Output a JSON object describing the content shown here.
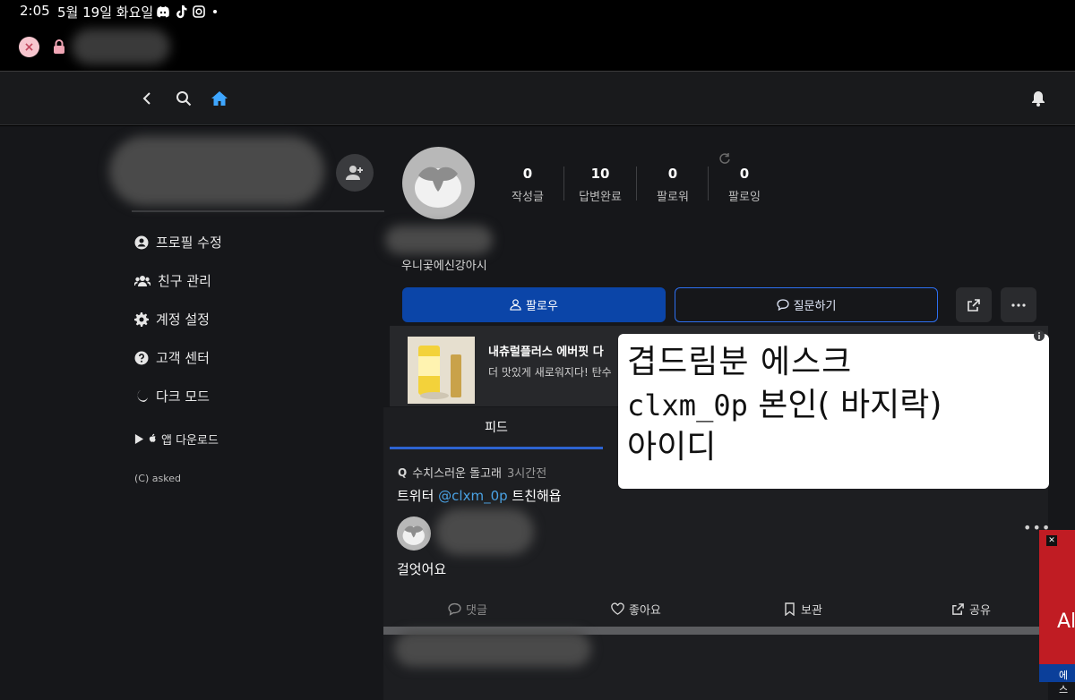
{
  "status_bar": {
    "time": "2:05",
    "date": "5월 19일 화요일",
    "icons": [
      "discord-icon",
      "tiktok-icon",
      "instagram-icon",
      "dot-icon"
    ]
  },
  "browser": {
    "close_icon": "×",
    "lock_icon": "lock-icon"
  },
  "nav": {
    "back_icon": "chevron-left-icon",
    "search_icon": "search-icon",
    "home_icon": "home-icon",
    "bell_icon": "bell-icon",
    "home_color": "#3ea6ff"
  },
  "sidebar": {
    "items": [
      {
        "label": "프로필 수정",
        "icon": "user-circle-icon"
      },
      {
        "label": "친구 관리",
        "icon": "users-icon"
      },
      {
        "label": "계정 설정",
        "icon": "gear-icon"
      },
      {
        "label": "고객 센터",
        "icon": "question-circle-icon"
      },
      {
        "label": "다크 모드",
        "icon": "moon-icon"
      }
    ],
    "app_download": "앱 다운로드",
    "copyright": "(C) asked"
  },
  "profile": {
    "stats": [
      {
        "value": "0",
        "label": "작성글"
      },
      {
        "value": "10",
        "label": "답변완료"
      },
      {
        "value": "0",
        "label": "팔로워"
      },
      {
        "value": "0",
        "label": "팔로잉"
      }
    ],
    "bio": "우니곷에신강아시",
    "follow_label": "팔로우",
    "ask_label": "질문하기"
  },
  "ad": {
    "title": "내츄럴플러스 에버핏 다",
    "desc": "더 맛있게 새로워지다! 탄수"
  },
  "feed": {
    "tab": "피드",
    "question": {
      "asker": "수치스러운 돌고래",
      "time": "3시간전",
      "prefix": "트위터 ",
      "mention": "@clxm_0p",
      "suffix": " 트친해욥"
    },
    "answer": "걸엇어요",
    "actions": {
      "comment": "댓글",
      "like": "좋아요",
      "save": "보관",
      "share": "공유"
    }
  },
  "note": {
    "line1": "겹드림분  에스크",
    "line2_mono": "clxm_0p",
    "line2_rest": " 본인( 바지락)",
    "line3": "아이디"
  },
  "side_ad": {
    "text": "Al",
    "bottom": "에스"
  }
}
